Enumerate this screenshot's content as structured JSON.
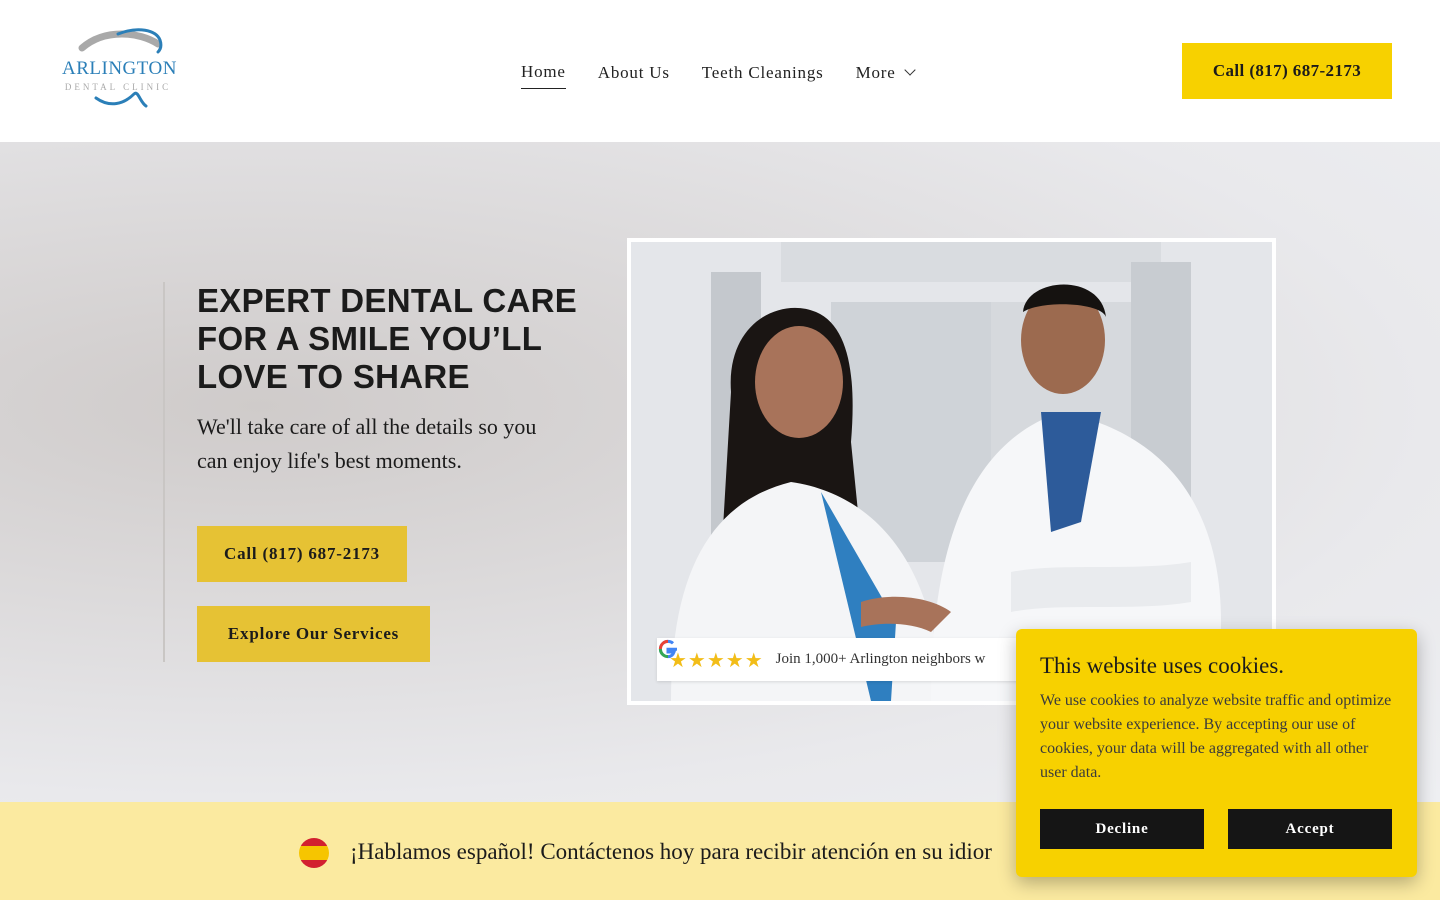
{
  "header": {
    "logo": {
      "name": "ARLINGTON",
      "sub": "DENTAL CLINIC"
    },
    "nav": [
      {
        "label": "Home",
        "active": true
      },
      {
        "label": "About Us"
      },
      {
        "label": "Teeth Cleanings"
      },
      {
        "label": "More"
      }
    ],
    "cta_label": "Call (817) 687-2173"
  },
  "hero": {
    "title": "EXPERT DENTAL CARE FOR A SMILE YOU’LL LOVE TO SHARE",
    "subtitle": "We'll take care of all the details so you can enjoy life's best moments.",
    "call_button": "Call (817) 687-2173",
    "explore_button": "Explore Our Services",
    "review": {
      "stars": "★★★★★",
      "text": "Join 1,000+ Arlington neighbors w"
    }
  },
  "banner": {
    "text": "¡Hablamos español! Contáctenos hoy para recibir atención en su idior"
  },
  "cookie": {
    "title": "This website uses cookies.",
    "body": "We use cookies to analyze website traffic and optimize your website experience. By accepting our use of cookies, your data will be aggregated with all other user data.",
    "decline": "Decline",
    "accept": "Accept"
  },
  "colors": {
    "accent": "#f7d100",
    "button": "#e6c234",
    "banner": "#fbeaa0",
    "logo_blue": "#2b7fb8"
  }
}
